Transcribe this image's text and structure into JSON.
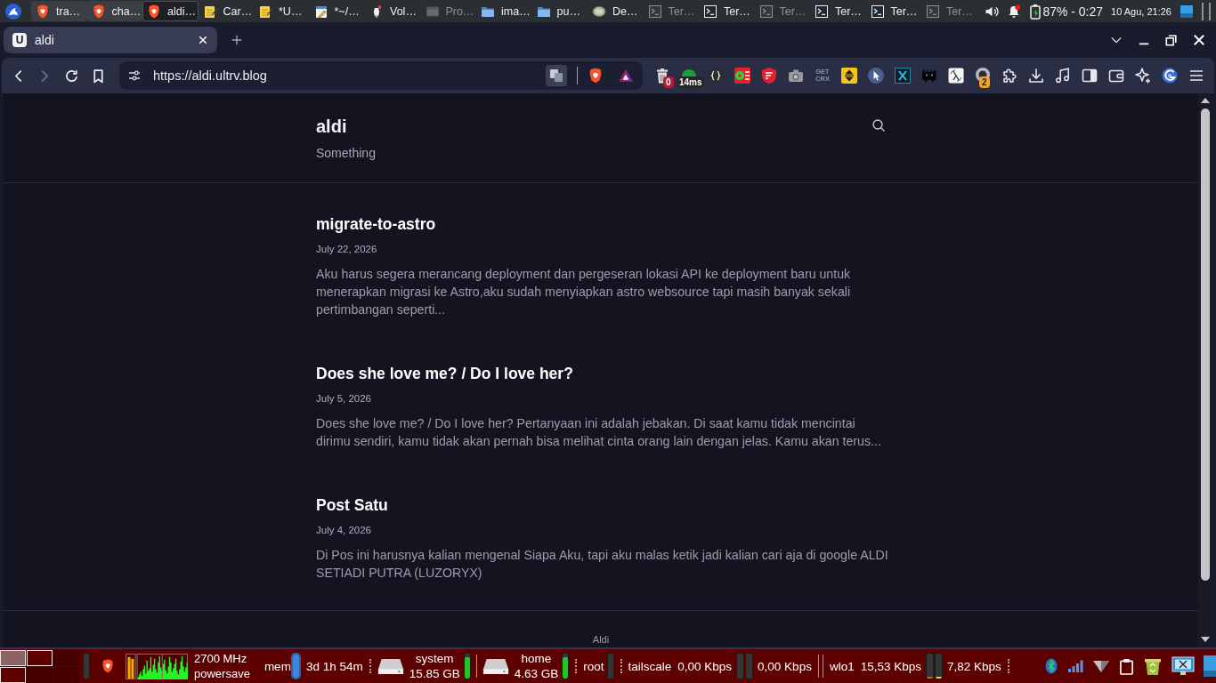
{
  "top_panel": {
    "tasks": [
      {
        "kind": "browser",
        "label": "tra…",
        "framed": true,
        "selected": false,
        "minimized": false
      },
      {
        "kind": "browser",
        "label": "cha…",
        "framed": true,
        "selected": false,
        "minimized": false
      },
      {
        "kind": "browser",
        "label": "aldi…",
        "framed": true,
        "selected": true,
        "minimized": false
      },
      {
        "kind": "notepad",
        "label": "Car…",
        "framed": false,
        "selected": false,
        "minimized": false
      },
      {
        "kind": "notepad",
        "label": "*U…",
        "framed": false,
        "selected": false,
        "minimized": false
      },
      {
        "kind": "editor",
        "label": "*~/…",
        "framed": false,
        "selected": false,
        "minimized": false
      },
      {
        "kind": "mixer",
        "label": "Vol…",
        "framed": false,
        "selected": false,
        "minimized": false
      },
      {
        "kind": "window",
        "label": "Pro…",
        "framed": false,
        "selected": false,
        "minimized": true
      },
      {
        "kind": "folder",
        "label": "ima…",
        "framed": false,
        "selected": false,
        "minimized": false
      },
      {
        "kind": "folder",
        "label": "pu…",
        "framed": false,
        "selected": false,
        "minimized": false
      },
      {
        "kind": "oval",
        "label": "De…",
        "framed": false,
        "selected": false,
        "minimized": false
      },
      {
        "kind": "terminal",
        "label": "Ter…",
        "framed": false,
        "selected": false,
        "minimized": true
      },
      {
        "kind": "terminal",
        "label": "Ter…",
        "framed": false,
        "selected": false,
        "minimized": false
      },
      {
        "kind": "terminal",
        "label": "Ter…",
        "framed": false,
        "selected": false,
        "minimized": true
      },
      {
        "kind": "terminal",
        "label": "Ter…",
        "framed": false,
        "selected": false,
        "minimized": false
      },
      {
        "kind": "terminal",
        "label": "Ter…",
        "framed": false,
        "selected": false,
        "minimized": false
      },
      {
        "kind": "terminal",
        "label": "Ter…",
        "framed": false,
        "selected": false,
        "minimized": true
      }
    ],
    "tray": {
      "notification": true,
      "battery": "87% - 0:27",
      "clock": "10 Agu, 21:26"
    }
  },
  "browser": {
    "tabs": [
      {
        "favicon": "U",
        "title": "aldi",
        "selected": true
      }
    ],
    "nav": [
      {
        "kind": "back",
        "disabled": false
      },
      {
        "kind": "forward",
        "disabled": true
      },
      {
        "kind": "reload",
        "disabled": false
      },
      {
        "kind": "bookmark",
        "disabled": false
      }
    ],
    "address": "https://aldi.ultrv.blog",
    "toolbar": [
      {
        "kind": "trash",
        "badge": "0"
      },
      {
        "kind": "ping",
        "badge": "14ms"
      },
      {
        "kind": "braces"
      },
      {
        "kind": "player"
      },
      {
        "kind": "shield"
      },
      {
        "kind": "camera"
      },
      {
        "kind": "getcrx",
        "label": "GET CRX"
      },
      {
        "kind": "updown"
      },
      {
        "kind": "pointer"
      },
      {
        "kind": "xtile"
      },
      {
        "kind": "cat"
      },
      {
        "kind": "lambda"
      },
      {
        "kind": "ring",
        "badge": "2"
      },
      {
        "kind": "puzzle"
      },
      {
        "kind": "download"
      },
      {
        "kind": "music"
      },
      {
        "kind": "sidebar"
      },
      {
        "kind": "wallet"
      },
      {
        "kind": "sparkle"
      },
      {
        "kind": "swirl"
      },
      {
        "kind": "menu"
      }
    ]
  },
  "page": {
    "site_title": "aldi",
    "tagline": "Something",
    "posts": [
      {
        "title": "migrate-to-astro",
        "date": "July 22, 2026",
        "excerpt": "Aku harus segera merancang deployment dan pergeseran lokasi API ke deployment baru untuk menerapkan migrasi ke Astro,aku sudah menyiapkan astro websource tapi masih banyak sekali pertimbangan seperti..."
      },
      {
        "title": "Does she love me? / Do I love her?",
        "date": "July 5, 2026",
        "excerpt": "Does she love me? / Do I love her? Pertanyaan ini adalah jebakan. Di saat kamu tidak mencintai dirimu sendiri, kamu tidak akan pernah bisa melihat cinta orang lain dengan jelas. Kamu akan terus..."
      },
      {
        "title": "Post Satu",
        "date": "July 4, 2026",
        "excerpt": "Di Pos ini harusnya kalian mengenal Siapa Aku, tapi aku malas ketik jadi kalian cari aja di google ALDI SETIADI PUTRA (LUZORYX)"
      }
    ],
    "footer": "Aldi"
  },
  "bottom_panel": {
    "pager": [
      {
        "selected": true,
        "occupied": true
      },
      {
        "selected": false,
        "occupied": true
      },
      {
        "selected": false,
        "occupied": false
      },
      {
        "selected": false,
        "occupied": true
      },
      {
        "selected": false,
        "occupied": false
      },
      {
        "selected": false,
        "occupied": false
      }
    ],
    "widgets": [
      {
        "kind": "meter"
      },
      {
        "kind": "launcher"
      },
      {
        "kind": "cpu"
      },
      {
        "kind": "cpufreq",
        "frequency": "2700 MHz",
        "governor": "powersave"
      },
      {
        "kind": "memory",
        "label": "mem",
        "level": 1,
        "color": "#3a86e0"
      },
      {
        "kind": "uptime",
        "text": "3d 1h 54m"
      },
      {
        "kind": "grip"
      },
      {
        "kind": "disk",
        "name": "system",
        "usage": "15.85 GB",
        "level": 0.85,
        "color": "#1ec81e"
      },
      {
        "kind": "rule"
      },
      {
        "kind": "disk",
        "name": "home",
        "usage": "4.63 GB",
        "level": 0.85,
        "color": "#1ec81e"
      },
      {
        "kind": "grip"
      },
      {
        "kind": "mount",
        "name": "root"
      },
      {
        "kind": "grip"
      },
      {
        "kind": "net",
        "name": "tailscale",
        "down": "0,00 Kbps",
        "up": "0,00 Kbps"
      },
      {
        "kind": "doublerule"
      },
      {
        "kind": "net",
        "name": "wlo1",
        "down": "15,53 Kbps",
        "up": "7,82 Kbps",
        "meters": [
          {
            "level": 0.07,
            "color": "#f0541a"
          },
          {
            "level": 0.07,
            "color": "#f2d41c"
          }
        ]
      },
      {
        "kind": "grip"
      }
    ],
    "tray": [
      {
        "kind": "bluetooth"
      },
      {
        "kind": "signal"
      },
      {
        "kind": "triangle"
      },
      {
        "kind": "clipboard"
      },
      {
        "kind": "recycle"
      },
      {
        "kind": "screenshot"
      },
      {
        "kind": "screen"
      }
    ]
  }
}
